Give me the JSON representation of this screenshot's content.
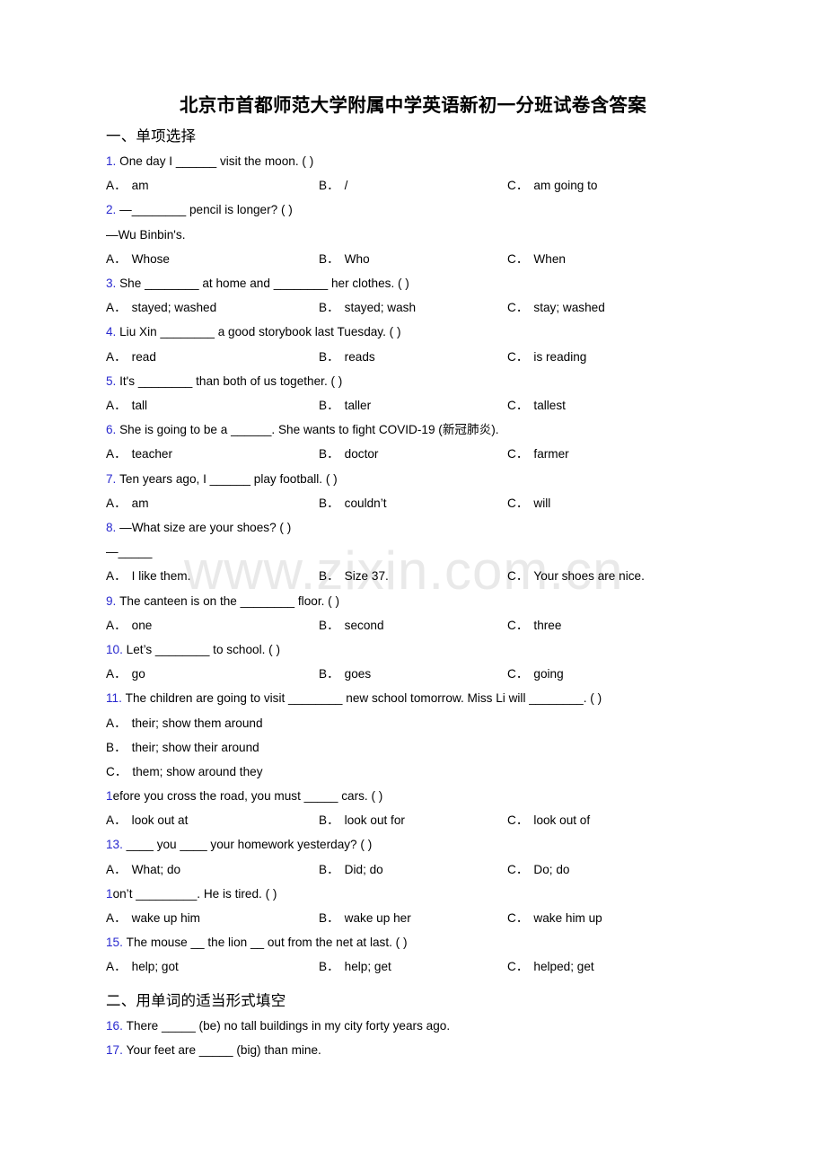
{
  "document": {
    "title": "北京市首都师范大学附属中学英语新初一分班试卷含答案",
    "watermark": "www.zixin.com.cn",
    "blue_number_color": "#2929cf"
  },
  "sections": [
    {
      "heading": "一、单项选择",
      "questions": [
        {
          "number": "1.",
          "stem": "One day I ______ visit the moon. (   )",
          "continuation": null,
          "layout": "columns",
          "options": [
            {
              "letter": "A．",
              "text": "am"
            },
            {
              "letter": "B．",
              "text": "/"
            },
            {
              "letter": "C．",
              "text": "am going to"
            }
          ]
        },
        {
          "number": "2.",
          "stem": "—________ pencil is longer? (   )",
          "continuation": "—Wu Binbin's.",
          "layout": "columns",
          "options": [
            {
              "letter": "A．",
              "text": "Whose"
            },
            {
              "letter": "B．",
              "text": "Who"
            },
            {
              "letter": "C．",
              "text": "When"
            }
          ]
        },
        {
          "number": "3.",
          "stem": "She ________ at home and ________ her clothes. (   )",
          "continuation": null,
          "layout": "columns",
          "options": [
            {
              "letter": "A．",
              "text": "stayed; washed"
            },
            {
              "letter": "B．",
              "text": "stayed; wash"
            },
            {
              "letter": "C．",
              "text": "stay; washed"
            }
          ]
        },
        {
          "number": "4.",
          "stem": "Liu Xin ________ a good storybook last Tuesday. (    )",
          "continuation": null,
          "layout": "columns",
          "options": [
            {
              "letter": "A．",
              "text": "read"
            },
            {
              "letter": "B．",
              "text": "reads"
            },
            {
              "letter": "C．",
              "text": "is reading"
            }
          ]
        },
        {
          "number": "5.",
          "stem": "It's ________ than both of us together. (    )",
          "continuation": null,
          "layout": "columns",
          "options": [
            {
              "letter": "A．",
              "text": "tall"
            },
            {
              "letter": "B．",
              "text": "taller"
            },
            {
              "letter": "C．",
              "text": "tallest"
            }
          ]
        },
        {
          "number": "6.",
          "stem": "She is going to be a ______. She wants to fight COVID-19 (新冠肺炎).",
          "continuation": null,
          "layout": "columns",
          "options": [
            {
              "letter": "A．",
              "text": "teacher"
            },
            {
              "letter": "B．",
              "text": "doctor"
            },
            {
              "letter": "C．",
              "text": "farmer"
            }
          ]
        },
        {
          "number": "7.",
          "stem": "Ten years ago, I ______ play football. (    )",
          "continuation": null,
          "layout": "columns",
          "options": [
            {
              "letter": "A．",
              "text": "am"
            },
            {
              "letter": "B．",
              "text": "couldn’t"
            },
            {
              "letter": "C．",
              "text": "will"
            }
          ]
        },
        {
          "number": "8.",
          "stem": "—What size are your shoes? (   )",
          "continuation": "—_____",
          "layout": "columns",
          "options": [
            {
              "letter": "A．",
              "text": "I like them."
            },
            {
              "letter": "B．",
              "text": "Size 37."
            },
            {
              "letter": "C．",
              "text": "Your shoes are nice."
            }
          ]
        },
        {
          "number": "9.",
          "stem": "The canteen is on the ________ floor. (    )",
          "continuation": null,
          "layout": "columns",
          "options": [
            {
              "letter": "A．",
              "text": "one"
            },
            {
              "letter": "B．",
              "text": "second"
            },
            {
              "letter": "C．",
              "text": "three"
            }
          ]
        },
        {
          "number": "10.",
          "stem": "Let’s ________ to school. (    )",
          "continuation": null,
          "layout": "columns",
          "options": [
            {
              "letter": "A．",
              "text": "go"
            },
            {
              "letter": "B．",
              "text": "goes"
            },
            {
              "letter": "C．",
              "text": "going"
            }
          ]
        },
        {
          "number": "11.",
          "stem": "The children are going to visit ________ new school tomorrow. Miss Li will ________. (   )",
          "continuation": null,
          "layout": "stacked",
          "options": [
            {
              "letter": "A．",
              "text": "their; show them around"
            },
            {
              "letter": "B．",
              "text": "their; show their around"
            },
            {
              "letter": "C．",
              "text": "them; show around they"
            }
          ]
        },
        {
          "number": "1",
          "stem": "efore you cross the road, you must _____ cars. (  )",
          "continuation": null,
          "layout": "columns",
          "options": [
            {
              "letter": "A．",
              "text": "look out at"
            },
            {
              "letter": "B．",
              "text": "look out for"
            },
            {
              "letter": "C．",
              "text": "look out of"
            }
          ]
        },
        {
          "number": "13.",
          "stem": "____ you ____ your homework yesterday? (  )",
          "continuation": null,
          "layout": "columns",
          "options": [
            {
              "letter": "A．",
              "text": "What; do"
            },
            {
              "letter": "B．",
              "text": "Did; do"
            },
            {
              "letter": "C．",
              "text": "Do; do"
            }
          ]
        },
        {
          "number": "1",
          "stem": "on’t _________. He is tired. (    )",
          "continuation": null,
          "layout": "columns",
          "options": [
            {
              "letter": "A．",
              "text": "wake up him"
            },
            {
              "letter": "B．",
              "text": "wake up her"
            },
            {
              "letter": "C．",
              "text": "wake him up"
            }
          ]
        },
        {
          "number": "15.",
          "stem": "The mouse __ the lion __ out from the net at last. (  )",
          "continuation": null,
          "layout": "columns",
          "options": [
            {
              "letter": "A．",
              "text": "help; got"
            },
            {
              "letter": "B．",
              "text": "help; get"
            },
            {
              "letter": "C．",
              "text": "helped; get"
            }
          ]
        }
      ]
    },
    {
      "heading": "二、用单词的适当形式填空",
      "questions": [
        {
          "number": "16.",
          "stem": "There _____ (be) no tall buildings in my city forty years ago.",
          "continuation": null,
          "layout": "none",
          "options": []
        },
        {
          "number": "17.",
          "stem": "Your feet are _____ (big) than mine.",
          "continuation": null,
          "layout": "none",
          "options": []
        }
      ]
    }
  ]
}
